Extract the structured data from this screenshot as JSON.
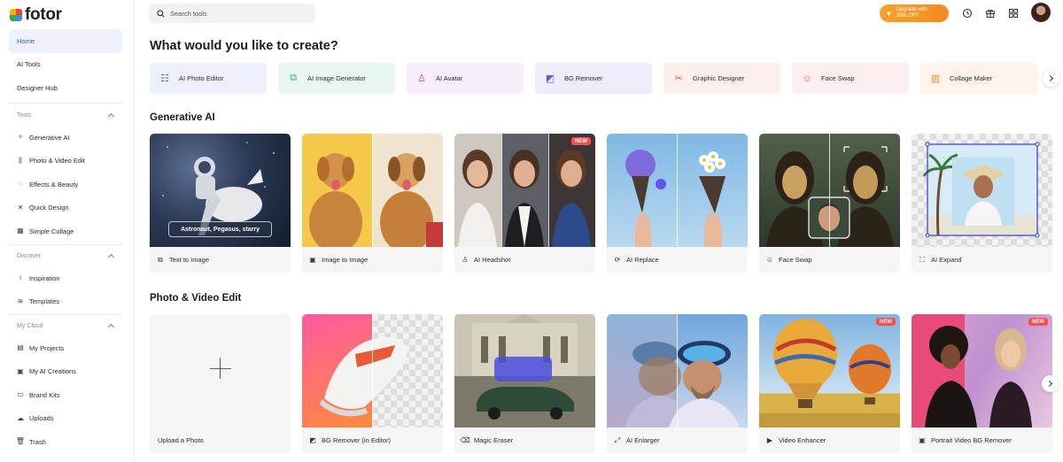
{
  "brand": {
    "name": "fotor",
    "colors": [
      "#f4b400",
      "#e94235",
      "#34a853",
      "#4285f4"
    ]
  },
  "search": {
    "placeholder": "Search tools"
  },
  "header": {
    "upgrade_line1": "Upgrade with",
    "upgrade_line2": "20% OFF",
    "icons": [
      "history-icon",
      "gift-icon",
      "apps-grid-icon"
    ]
  },
  "sidebar": {
    "main_items": [
      {
        "label": "Home",
        "active": true
      },
      {
        "label": "AI Tools"
      },
      {
        "label": "Designer Hub"
      }
    ],
    "tools_title": "Tools",
    "tools": [
      {
        "label": "Generative AI",
        "icon": "sparkle-icon"
      },
      {
        "label": "Photo & Video Edit",
        "icon": "sliders-icon"
      },
      {
        "label": "Effects & Beauty",
        "icon": "effects-icon"
      },
      {
        "label": "Quick Design",
        "icon": "design-icon"
      },
      {
        "label": "Simple Collage",
        "icon": "collage-icon"
      }
    ],
    "discover_title": "Discover",
    "discover": [
      {
        "label": "Inspiration",
        "icon": "bulb-icon"
      },
      {
        "label": "Templates",
        "icon": "layers-icon"
      }
    ],
    "cloud_title": "My Cloud",
    "cloud": [
      {
        "label": "My Projects",
        "icon": "projects-icon"
      },
      {
        "label": "My AI Creations",
        "icon": "ai-creations-icon"
      },
      {
        "label": "Brand Kits",
        "icon": "brand-kit-icon"
      },
      {
        "label": "Uploads",
        "icon": "upload-icon"
      },
      {
        "label": "Trash",
        "icon": "trash-icon"
      }
    ]
  },
  "main": {
    "title": "What would you like to create?",
    "quick_tools": [
      {
        "label": "AI Photo Editor",
        "bg": "#eef1fd",
        "color": "#4a63d8"
      },
      {
        "label": "AI Image Generator",
        "bg": "#e9f7f3",
        "color": "#27a87a"
      },
      {
        "label": "AI Avatar",
        "bg": "#f8eefb",
        "color": "#b04ad0"
      },
      {
        "label": "BG Remover",
        "bg": "#efedfc",
        "color": "#6a57d8"
      },
      {
        "label": "Graphic Designer",
        "bg": "#fdefec",
        "color": "#e0554a"
      },
      {
        "label": "Face Swap",
        "bg": "#fdeef1",
        "color": "#e25a7a"
      },
      {
        "label": "Collage Maker",
        "bg": "#fdf3ea",
        "color": "#ee8a3a"
      }
    ],
    "generative_title": "Generative AI",
    "generative": [
      {
        "label": "Text to Image",
        "caption": "Astronaut, Pegasus, starry"
      },
      {
        "label": "Image to Image"
      },
      {
        "label": "AI Headshot",
        "badge": "NEW"
      },
      {
        "label": "AI Replace"
      },
      {
        "label": "Face Swap"
      },
      {
        "label": "AI Expand"
      }
    ],
    "photo_title": "Photo & Video Edit",
    "photo": [
      {
        "label": "Upload a Photo"
      },
      {
        "label": "BG Remover (in Editor)"
      },
      {
        "label": "Magic Eraser"
      },
      {
        "label": "AI Enlarger"
      },
      {
        "label": "Video Enhancer",
        "badge": "NEW"
      },
      {
        "label": "Portrait Video BG Remover",
        "badge": "NEW"
      }
    ]
  }
}
